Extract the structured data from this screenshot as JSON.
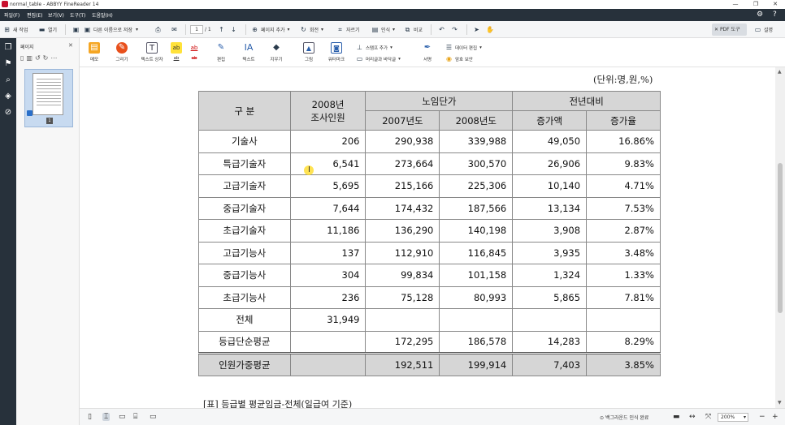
{
  "window": {
    "title": "normal_table - ABBYY FineReader 14",
    "controls": [
      "—",
      "❐",
      "✕"
    ]
  },
  "menu": [
    "파일(F)",
    "편집(E)",
    "보기(V)",
    "도구(T)",
    "도움말(H)"
  ],
  "toolbar": {
    "new_task": "새 작업",
    "open": "열기",
    "save_as": "다른 이름으로 저장",
    "page_current": "1",
    "page_total": "/ 1",
    "add_page": "페이지 추가",
    "rotate": "회전",
    "crop": "자르기",
    "recognize": "인식",
    "compare": "비교",
    "pdf_tools": "PDF 도구",
    "help": "설명"
  },
  "ribbon": {
    "memo": "메모",
    "draw": "그리기",
    "textbox": "텍스트 상자",
    "highlight_a": "ab",
    "strike_a": "ab",
    "edit": "편집",
    "text": "텍스트",
    "erase": "지우기",
    "image": "그림",
    "watermark": "워터마크",
    "stamp_add": "스탬프 추가",
    "header_footer": "머리글과 바닥글",
    "sign": "서명",
    "data_edit": "데이터 편집",
    "protect": "암호 보안"
  },
  "pages_panel": {
    "title": "페이지",
    "thumb_number": "1"
  },
  "document": {
    "unit_note": "(단위:명,원,%)",
    "headers": {
      "category": "구   분",
      "survey_year": "2008년",
      "survey_label": "조사인원",
      "avg_wage": "노임단가",
      "prev_compare": "전년대비",
      "y2007": "2007년도",
      "y2008": "2008년도",
      "increase_amount": "증가액",
      "increase_rate": "증가율"
    },
    "rows": [
      {
        "label": "기술사",
        "count": "206",
        "y2007": "290,938",
        "y2008": "339,988",
        "amount": "49,050",
        "rate": "16.86%"
      },
      {
        "label": "특급기술자",
        "count": "6,541",
        "y2007": "273,664",
        "y2008": "300,570",
        "amount": "26,906",
        "rate": "9.83%"
      },
      {
        "label": "고급기술자",
        "count": "5,695",
        "y2007": "215,166",
        "y2008": "225,306",
        "amount": "10,140",
        "rate": "4.71%"
      },
      {
        "label": "중급기술자",
        "count": "7,644",
        "y2007": "174,432",
        "y2008": "187,566",
        "amount": "13,134",
        "rate": "7.53%"
      },
      {
        "label": "초급기술자",
        "count": "11,186",
        "y2007": "136,290",
        "y2008": "140,198",
        "amount": "3,908",
        "rate": "2.87%"
      },
      {
        "label": "고급기능사",
        "count": "137",
        "y2007": "112,910",
        "y2008": "116,845",
        "amount": "3,935",
        "rate": "3.48%"
      },
      {
        "label": "중급기능사",
        "count": "304",
        "y2007": "99,834",
        "y2008": "101,158",
        "amount": "1,324",
        "rate": "1.33%"
      },
      {
        "label": "초급기능사",
        "count": "236",
        "y2007": "75,128",
        "y2008": "80,993",
        "amount": "5,865",
        "rate": "7.81%"
      },
      {
        "label": "전체",
        "count": "31,949",
        "y2007": "",
        "y2008": "",
        "amount": "",
        "rate": ""
      },
      {
        "label": "등급단순평균",
        "count": "",
        "y2007": "172,295",
        "y2008": "186,578",
        "amount": "14,283",
        "rate": "8.29%"
      }
    ],
    "total_row": {
      "label": "인원가중평균",
      "count": "",
      "y2007": "192,511",
      "y2008": "199,914",
      "amount": "7,403",
      "rate": "3.85%"
    },
    "caption": "[표] 등급별 평균임금-전체(일급여 기준)"
  },
  "statusbar": {
    "background_recognition": "백그라운드 인식 완료",
    "zoom": "200%"
  }
}
